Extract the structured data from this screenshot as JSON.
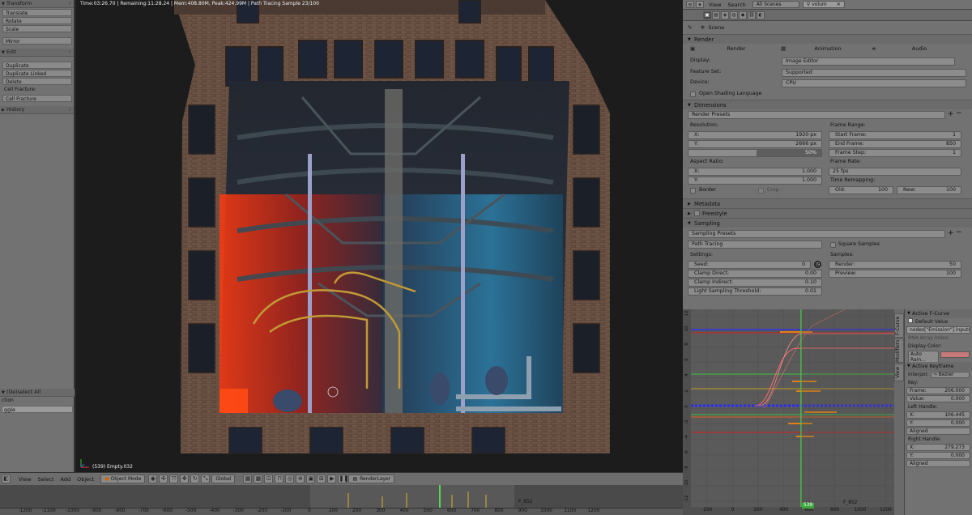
{
  "toolshelf": {
    "transform": {
      "header": "Transform",
      "items": [
        "Translate",
        "Rotate",
        "Scale"
      ],
      "mirror": "Mirror"
    },
    "edit": {
      "header": "Edit",
      "items": [
        "Duplicate",
        "Duplicate Linked",
        "Delete"
      ],
      "cell_fracture_label": "Cell Fracture:",
      "cell_fracture_btn": "Cell Fracture"
    },
    "history": {
      "header": "History"
    },
    "last_op": {
      "title": "(De)select All",
      "action_label": "ction",
      "action_value": "ggle"
    }
  },
  "viewport": {
    "render_info": "Time:03:26.70 | Remaining:11:28.24 | Mem:408.80M, Peak:424.99M | Path Tracing Sample 23/100",
    "object_label": "(539) Empty.032"
  },
  "vp_header": {
    "menus": [
      "View",
      "Select",
      "Add",
      "Object"
    ],
    "mode": "Object Mode",
    "pivot": "Global",
    "layer": "RenderLayer"
  },
  "timeline": {
    "ruler": [
      "-1200",
      "-1100",
      "-1000",
      "-900",
      "-800",
      "-700",
      "-600",
      "-500",
      "-400",
      "-300",
      "-200",
      "-100",
      "0",
      "100",
      "200",
      "300",
      "400",
      "500",
      "600",
      "700",
      "800",
      "900",
      "1000",
      "1100",
      "1200"
    ],
    "marker": "F_852"
  },
  "props_header": {
    "menus": [
      "View",
      "Search"
    ],
    "scene_select": "All Scenes",
    "search_value": "volum"
  },
  "props": {
    "scene": "Scene",
    "render": {
      "header": "Render",
      "buttons": [
        "Render",
        "Animation",
        "Audio"
      ],
      "display_label": "Display:",
      "display_value": "Image Editor",
      "feature_label": "Feature Set:",
      "feature_value": "Supported",
      "device_label": "Device:",
      "device_value": "CPU",
      "osl": "Open Shading Language"
    },
    "dimensions": {
      "header": "Dimensions",
      "presets": "Render Presets",
      "resolution_label": "Resolution:",
      "res_x_label": "X:",
      "res_x": "1920 px",
      "res_y_label": "Y:",
      "res_y": "2666 px",
      "res_pct": "50%",
      "aspect_label": "Aspect Ratio:",
      "asp_x_label": "X:",
      "asp_x": "1.000",
      "asp_y_label": "Y:",
      "asp_y": "1.000",
      "border": "Border",
      "crop": "Crop",
      "frame_range_label": "Frame Range:",
      "start_label": "Start Frame:",
      "start": "1",
      "end_label": "End Frame:",
      "end": "850",
      "step_label": "Frame Step:",
      "step": "1",
      "frame_rate_label": "Frame Rate:",
      "frame_rate": "25 fps",
      "remap_label": "Time Remapping:",
      "old_label": "Old:",
      "old": "100",
      "new_label": "New:",
      "new": "100"
    },
    "metadata": {
      "header": "Metadata"
    },
    "freestyle": {
      "header": "Freestyle"
    },
    "sampling": {
      "header": "Sampling",
      "presets": "Sampling Presets",
      "integrator": "Path Tracing",
      "square": "Square Samples",
      "settings_label": "Settings:",
      "seed_label": "Seed:",
      "seed": "0",
      "clamp_direct_label": "Clamp Direct:",
      "clamp_direct": "0.00",
      "clamp_indirect_label": "Clamp Indirect:",
      "clamp_indirect": "0.10",
      "light_thresh_label": "Light Sampling Threshold:",
      "light_thresh": "0.01",
      "samples_label": "Samples:",
      "render_label": "Render:",
      "render": "50",
      "preview_label": "Preview:",
      "preview": "100"
    }
  },
  "graph": {
    "y_labels": [
      "12",
      "10",
      "8",
      "6",
      "4",
      "2",
      "0",
      "-2",
      "-4",
      "-6",
      "-8",
      "-10",
      "-12"
    ],
    "x_labels": [
      "-200",
      "0",
      "200",
      "400",
      "600",
      "800",
      "1000",
      "1200"
    ],
    "current_frame": "539",
    "marker": "F_852"
  },
  "graph_tabs": [
    "F-Curve",
    "Modifiers",
    "View"
  ],
  "graph_side": {
    "active_fcurve": "Active F-Curve",
    "default_value": "Default Value (Strength)",
    "rna_path": "nodes[\"Emission\"].inputs[1].default_value",
    "rna_index": "RNA Array Index:",
    "display_color": "Display Color:",
    "auto_rainbow": "Auto Rain...",
    "active_keyframe": "Active Keyframe",
    "interp_label": "Interpol:",
    "interp_value": "Bezier",
    "key_label": "Key:",
    "frame_label": "Frame:",
    "frame": "206.000",
    "value_label": "Value:",
    "value": "0.000",
    "left_handle": "Left Handle:",
    "lx_label": "X:",
    "lx": "106.445",
    "ly_label": "Y:",
    "ly": "0.000",
    "left_type": "Aligned",
    "right_handle": "Right Handle:",
    "rx_label": "X:",
    "rx": "279.273",
    "ry_label": "Y:",
    "ry": "0.000",
    "right_type": "Aligned"
  }
}
